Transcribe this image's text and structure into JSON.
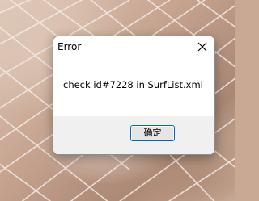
{
  "dialog": {
    "title": "Error",
    "message": "check id#7228 in SurfList.xml",
    "ok_label": "确定",
    "close_icon": "close-icon"
  },
  "colors": {
    "dialog_bg": "#ffffff",
    "footer_bg": "#f0f0f0",
    "button_border": "#0067c0",
    "button_bg": "#e5e5e5"
  }
}
